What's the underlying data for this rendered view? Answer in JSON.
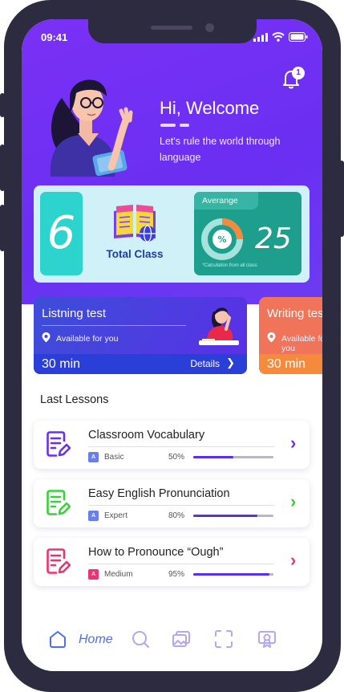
{
  "status_bar": {
    "time": "09:41"
  },
  "notifications": {
    "count": "1"
  },
  "welcome": {
    "title": "Hi, Welcome",
    "subtitle": "Let's rule the world through language"
  },
  "stats": {
    "total_class_count": "6",
    "total_class_label": "Total Class",
    "average_label": "Averange",
    "average_value": "25",
    "average_note": "*Calculation from all class"
  },
  "tests": [
    {
      "title": "Listning test",
      "availability": "Available for you",
      "duration": "30 min",
      "details_label": "Details"
    },
    {
      "title": "Writing test",
      "availability": "Available for you",
      "duration": "30 min"
    }
  ],
  "lessons_section": {
    "title": "Last Lessons"
  },
  "lessons": [
    {
      "title": "Classroom Vocabulary",
      "level": "Basic",
      "progress_label": "50%",
      "progress": 0.5,
      "color": "#6a2ff2",
      "level_color": "#6a7ef0"
    },
    {
      "title": "Easy English Pronunciation",
      "level": "Expert",
      "progress_label": "80%",
      "progress": 0.8,
      "color": "#39d13a",
      "level_color": "#6a7ef0"
    },
    {
      "title": "How to Pronounce “Ough”",
      "level": "Medium",
      "progress_label": "95%",
      "progress": 0.95,
      "color": "#f0326e",
      "level_color": "#f0326e"
    }
  ],
  "nav": {
    "home_label": "Home",
    "active_color": "#4f6fe8",
    "inactive_color": "#b4a6ef",
    "items": [
      "home-icon",
      "search-icon",
      "gallery-icon",
      "scan-icon",
      "certificate-icon"
    ]
  }
}
